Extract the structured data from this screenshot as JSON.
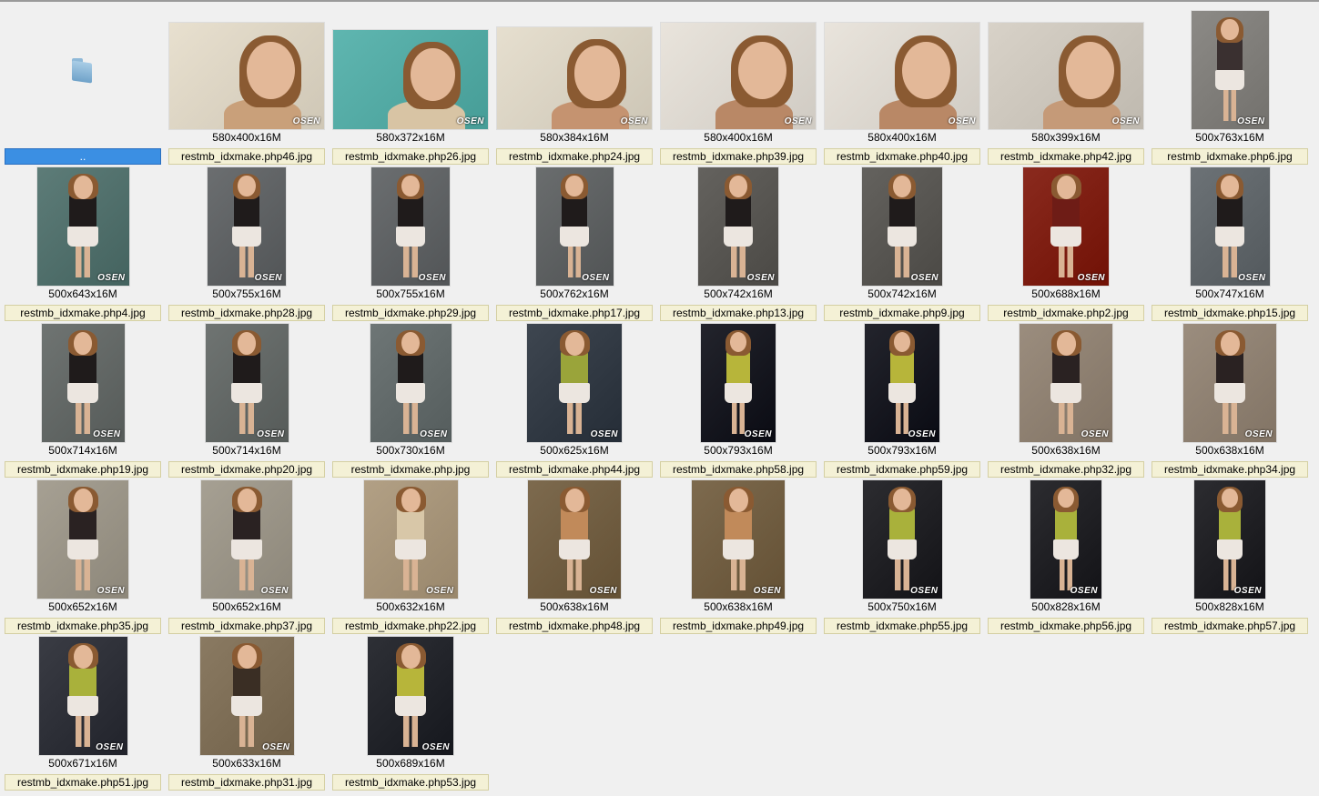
{
  "parent_folder": {
    "label": "..",
    "icon": "folder-up-icon",
    "selected": true
  },
  "accent_color": "#3b8fe3",
  "label_bg_color": "#f4f1d6",
  "items": [
    {
      "dims": "580x400x16M",
      "name": "restmb_idxmake.php46.jpg",
      "w": 170,
      "h": 117,
      "tone": "#c9a07a",
      "bg": "#e8e0cf"
    },
    {
      "dims": "580x372x16M",
      "name": "restmb_idxmake.php26.jpg",
      "w": 170,
      "h": 109,
      "tone": "#d8c4a4",
      "bg": "#5fb6b0"
    },
    {
      "dims": "580x384x16M",
      "name": "restmb_idxmake.php24.jpg",
      "w": 170,
      "h": 112,
      "tone": "#c59370",
      "bg": "#e6dfcf"
    },
    {
      "dims": "580x400x16M",
      "name": "restmb_idxmake.php39.jpg",
      "w": 170,
      "h": 117,
      "tone": "#b98866",
      "bg": "#e9e4dc"
    },
    {
      "dims": "580x400x16M",
      "name": "restmb_idxmake.php40.jpg",
      "w": 170,
      "h": 117,
      "tone": "#b98866",
      "bg": "#e9e4dc"
    },
    {
      "dims": "580x399x16M",
      "name": "restmb_idxmake.php42.jpg",
      "w": 170,
      "h": 117,
      "tone": "#c59a78",
      "bg": "#d8d2c8"
    },
    {
      "dims": "500x763x16M",
      "name": "restmb_idxmake.php6.jpg",
      "w": 85,
      "h": 130,
      "tone": "#3a3030",
      "bg": "#8c8a86"
    },
    {
      "dims": "500x643x16M",
      "name": "restmb_idxmake.php4.jpg",
      "w": 101,
      "h": 130,
      "tone": "#1f1b1b",
      "bg": "#5d7c78"
    },
    {
      "dims": "500x755x16M",
      "name": "restmb_idxmake.php28.jpg",
      "w": 86,
      "h": 130,
      "tone": "#1f1b1b",
      "bg": "#6b6e70"
    },
    {
      "dims": "500x755x16M",
      "name": "restmb_idxmake.php29.jpg",
      "w": 86,
      "h": 130,
      "tone": "#1f1b1b",
      "bg": "#6b6e70"
    },
    {
      "dims": "500x762x16M",
      "name": "restmb_idxmake.php17.jpg",
      "w": 85,
      "h": 130,
      "tone": "#1f1b1b",
      "bg": "#6a6d6e"
    },
    {
      "dims": "500x742x16M",
      "name": "restmb_idxmake.php13.jpg",
      "w": 88,
      "h": 130,
      "tone": "#1f1b1b",
      "bg": "#64625e"
    },
    {
      "dims": "500x742x16M",
      "name": "restmb_idxmake.php9.jpg",
      "w": 88,
      "h": 130,
      "tone": "#1f1b1b",
      "bg": "#64625e"
    },
    {
      "dims": "500x688x16M",
      "name": "restmb_idxmake.php2.jpg",
      "w": 94,
      "h": 130,
      "tone": "#6e1c16",
      "bg": "#8a2a1e"
    },
    {
      "dims": "500x747x16M",
      "name": "restmb_idxmake.php15.jpg",
      "w": 87,
      "h": 130,
      "tone": "#1f1b1b",
      "bg": "#6c7276"
    },
    {
      "dims": "500x714x16M",
      "name": "restmb_idxmake.php19.jpg",
      "w": 91,
      "h": 130,
      "tone": "#1f1b1b",
      "bg": "#6f7472"
    },
    {
      "dims": "500x714x16M",
      "name": "restmb_idxmake.php20.jpg",
      "w": 91,
      "h": 130,
      "tone": "#1f1b1b",
      "bg": "#6f7472"
    },
    {
      "dims": "500x730x16M",
      "name": "restmb_idxmake.php.jpg",
      "w": 89,
      "h": 130,
      "tone": "#1f1b1b",
      "bg": "#6e7676"
    },
    {
      "dims": "500x625x16M",
      "name": "restmb_idxmake.php44.jpg",
      "w": 104,
      "h": 130,
      "tone": "#9aa43a",
      "bg": "#3e4650"
    },
    {
      "dims": "500x793x16M",
      "name": "restmb_idxmake.php58.jpg",
      "w": 82,
      "h": 130,
      "tone": "#b7b53a",
      "bg": "#23242c"
    },
    {
      "dims": "500x793x16M",
      "name": "restmb_idxmake.php59.jpg",
      "w": 82,
      "h": 130,
      "tone": "#b7b53a",
      "bg": "#23242c"
    },
    {
      "dims": "500x638x16M",
      "name": "restmb_idxmake.php32.jpg",
      "w": 102,
      "h": 130,
      "tone": "#2a2222",
      "bg": "#9b8d7e"
    },
    {
      "dims": "500x638x16M",
      "name": "restmb_idxmake.php34.jpg",
      "w": 102,
      "h": 130,
      "tone": "#2a2222",
      "bg": "#9b8d7e"
    },
    {
      "dims": "500x652x16M",
      "name": "restmb_idxmake.php35.jpg",
      "w": 100,
      "h": 130,
      "tone": "#2a2222",
      "bg": "#a6a093"
    },
    {
      "dims": "500x652x16M",
      "name": "restmb_idxmake.php37.jpg",
      "w": 100,
      "h": 130,
      "tone": "#2a2222",
      "bg": "#a6a093"
    },
    {
      "dims": "500x632x16M",
      "name": "restmb_idxmake.php22.jpg",
      "w": 103,
      "h": 130,
      "tone": "#d8c7a8",
      "bg": "#b2a085"
    },
    {
      "dims": "500x638x16M",
      "name": "restmb_idxmake.php48.jpg",
      "w": 102,
      "h": 130,
      "tone": "#c18a5a",
      "bg": "#7d6a4e"
    },
    {
      "dims": "500x638x16M",
      "name": "restmb_idxmake.php49.jpg",
      "w": 102,
      "h": 130,
      "tone": "#c18a5a",
      "bg": "#7d6a4e"
    },
    {
      "dims": "500x750x16M",
      "name": "restmb_idxmake.php55.jpg",
      "w": 87,
      "h": 130,
      "tone": "#a9b13b",
      "bg": "#2c2c30"
    },
    {
      "dims": "500x828x16M",
      "name": "restmb_idxmake.php56.jpg",
      "w": 78,
      "h": 130,
      "tone": "#a9b13b",
      "bg": "#2c2c30"
    },
    {
      "dims": "500x828x16M",
      "name": "restmb_idxmake.php57.jpg",
      "w": 78,
      "h": 130,
      "tone": "#a9b13b",
      "bg": "#2c2c30"
    },
    {
      "dims": "500x671x16M",
      "name": "restmb_idxmake.php51.jpg",
      "w": 97,
      "h": 130,
      "tone": "#a9b13b",
      "bg": "#3a3c44"
    },
    {
      "dims": "500x633x16M",
      "name": "restmb_idxmake.php31.jpg",
      "w": 103,
      "h": 130,
      "tone": "#3a2e24",
      "bg": "#8a7a62"
    },
    {
      "dims": "500x689x16M",
      "name": "restmb_idxmake.php53.jpg",
      "w": 94,
      "h": 130,
      "tone": "#b7b53a",
      "bg": "#2e3036"
    }
  ],
  "watermark": "OSEN"
}
